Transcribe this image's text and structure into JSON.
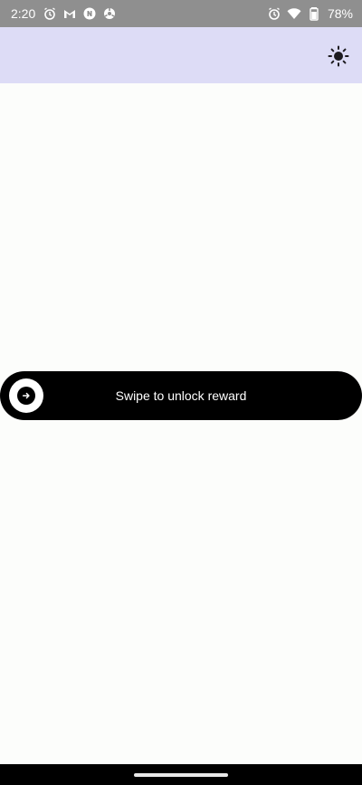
{
  "status_bar": {
    "time": "2:20",
    "battery": "78%",
    "left_icons": [
      "alarm-icon",
      "gmail-icon",
      "app-notification-icon",
      "sync-icon"
    ],
    "right_icons": [
      "alarm-icon",
      "wifi-icon",
      "battery-icon"
    ]
  },
  "app_bar": {
    "theme_icon": "brightness-icon",
    "background": "#dddcf6"
  },
  "swipe": {
    "label": "Swipe to unlock reward",
    "knob_icon": "arrow-right-icon"
  },
  "colors": {
    "track": "#000000",
    "knob": "#ffffff",
    "content_bg": "#fcfdfb"
  }
}
